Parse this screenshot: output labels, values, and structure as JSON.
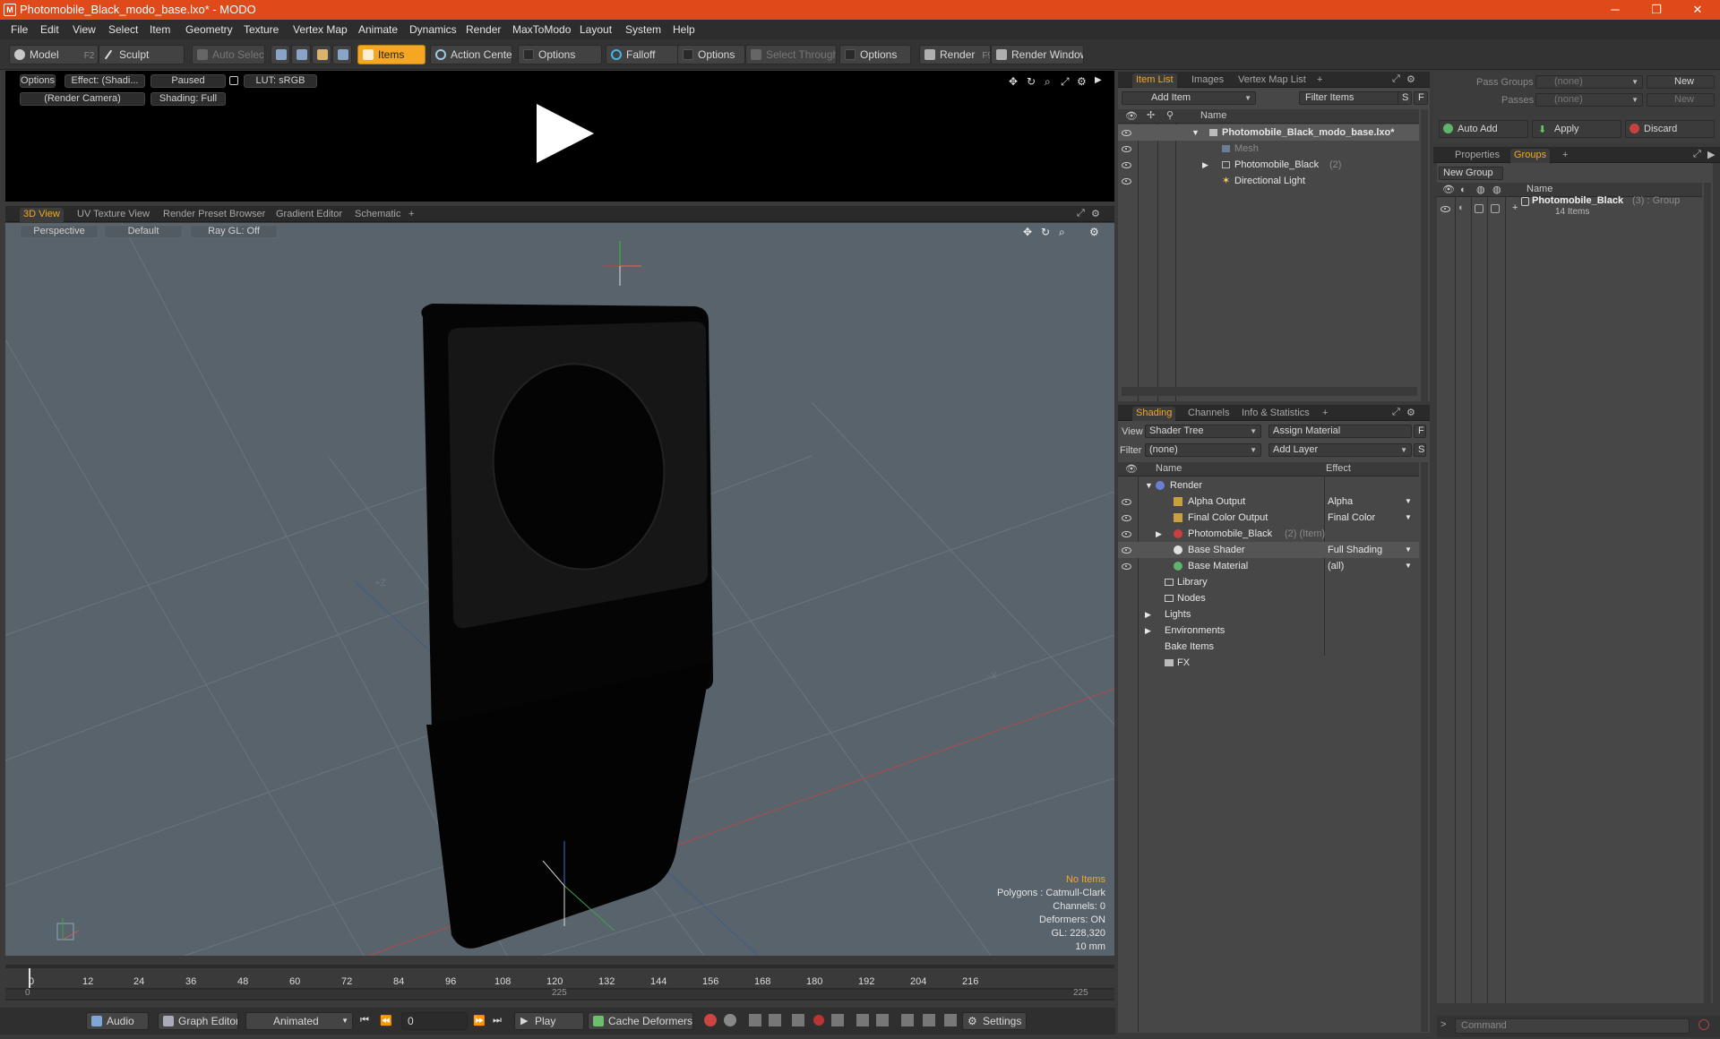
{
  "window": {
    "title": "Photomobile_Black_modo_base.lxo* - MODO",
    "logo": "M",
    "minimize": "─",
    "maximize": "❐",
    "close": "✕"
  },
  "menu": [
    "File",
    "Edit",
    "View",
    "Select",
    "Item",
    "Geometry",
    "Texture",
    "Vertex Map",
    "Animate",
    "Dynamics",
    "Render",
    "MaxToModo",
    "Layout",
    "System",
    "Help"
  ],
  "toolbar": {
    "model": "Model",
    "model_key": "F2",
    "sculpt": "Sculpt",
    "auto_select": "Auto Select",
    "items": "Items",
    "action_center": "Action Center",
    "options1": "Options",
    "falloff": "Falloff",
    "options2": "Options",
    "select_through": "Select Through",
    "options3": "Options",
    "render": "Render",
    "render_key": "F9",
    "render_window": "Render Window"
  },
  "preview": {
    "options": "Options",
    "effect": "Effect: (Shadi...",
    "paused": "Paused",
    "lut": "LUT: sRGB",
    "camera": "(Render Camera)",
    "shading": "Shading: Full"
  },
  "view_tabs": [
    "3D View",
    "UV Texture View",
    "Render Preset Browser",
    "Gradient Editor",
    "Schematic",
    "+"
  ],
  "viewport": {
    "perspective": "Perspective",
    "default": "Default",
    "raygl": "Ray GL: Off",
    "axis_z_pos": "+Z",
    "axis_x_neg": "-X",
    "info": {
      "no_items": "No Items",
      "polygons": "Polygons : Catmull-Clark",
      "channels": "Channels: 0",
      "deformers": "Deformers: ON",
      "gl": "GL: 228,320",
      "scale": "10 mm"
    }
  },
  "timeline": {
    "ticks": [
      "0",
      "12",
      "24",
      "36",
      "48",
      "60",
      "72",
      "84",
      "96",
      "108",
      "120",
      "132",
      "144",
      "156",
      "168",
      "180",
      "192",
      "204",
      "216"
    ],
    "range_start": "0",
    "range_mid": "225",
    "range_end": "225"
  },
  "bottom": {
    "audio": "Audio",
    "graph_editor": "Graph Editor",
    "animated": "Animated",
    "frame": "0",
    "play": "Play",
    "cache_deformers": "Cache Deformers",
    "settings": "Settings"
  },
  "item_list": {
    "tabs": [
      "Item List",
      "Images",
      "Vertex Map List",
      "+"
    ],
    "add_item": "Add Item",
    "filter_items": "Filter Items",
    "s": "S",
    "f": "F",
    "name_col": "Name",
    "rows": [
      {
        "label": "Photomobile_Black_modo_base.lxo*",
        "extra": ""
      },
      {
        "label": "Mesh",
        "extra": ""
      },
      {
        "label": "Photomobile_Black",
        "extra": "(2)"
      },
      {
        "label": "Directional Light",
        "extra": ""
      }
    ]
  },
  "shading": {
    "tabs": [
      "Shading",
      "Channels",
      "Info & Statistics",
      "+"
    ],
    "view_label": "View",
    "view_value": "Shader Tree",
    "assign_material": "Assign Material",
    "f": "F",
    "filter_label": "Filter",
    "filter_value": "(none)",
    "add_layer": "Add Layer",
    "s": "S",
    "name_col": "Name",
    "effect_col": "Effect",
    "rows": [
      {
        "label": "Render",
        "extra": "",
        "effect": ""
      },
      {
        "label": "Alpha Output",
        "extra": "",
        "effect": "Alpha"
      },
      {
        "label": "Final Color Output",
        "extra": "",
        "effect": "Final Color"
      },
      {
        "label": "Photomobile_Black",
        "extra": "(2) (Item)",
        "effect": ""
      },
      {
        "label": "Base Shader",
        "extra": "",
        "effect": "Full Shading"
      },
      {
        "label": "Base Material",
        "extra": "",
        "effect": "(all)"
      },
      {
        "label": "Library",
        "extra": "",
        "effect": ""
      },
      {
        "label": "Nodes",
        "extra": "",
        "effect": ""
      },
      {
        "label": "Lights",
        "extra": "",
        "effect": ""
      },
      {
        "label": "Environments",
        "extra": "",
        "effect": ""
      },
      {
        "label": "Bake Items",
        "extra": "",
        "effect": ""
      },
      {
        "label": "FX",
        "extra": "",
        "effect": ""
      }
    ]
  },
  "groups": {
    "pass_groups_label": "Pass Groups",
    "pass_groups_value": "(none)",
    "new1": "New",
    "passes_label": "Passes",
    "passes_value": "(none)",
    "new2": "New",
    "auto_add": "Auto Add",
    "apply": "Apply",
    "discard": "Discard",
    "tabs": [
      "Properties",
      "Groups",
      "+"
    ],
    "new_group": "New Group",
    "name_col": "Name",
    "group_name": "Photomobile_Black",
    "group_extra": "(3) : Group",
    "group_items": "14 Items"
  },
  "command": {
    "placeholder": "Command"
  }
}
